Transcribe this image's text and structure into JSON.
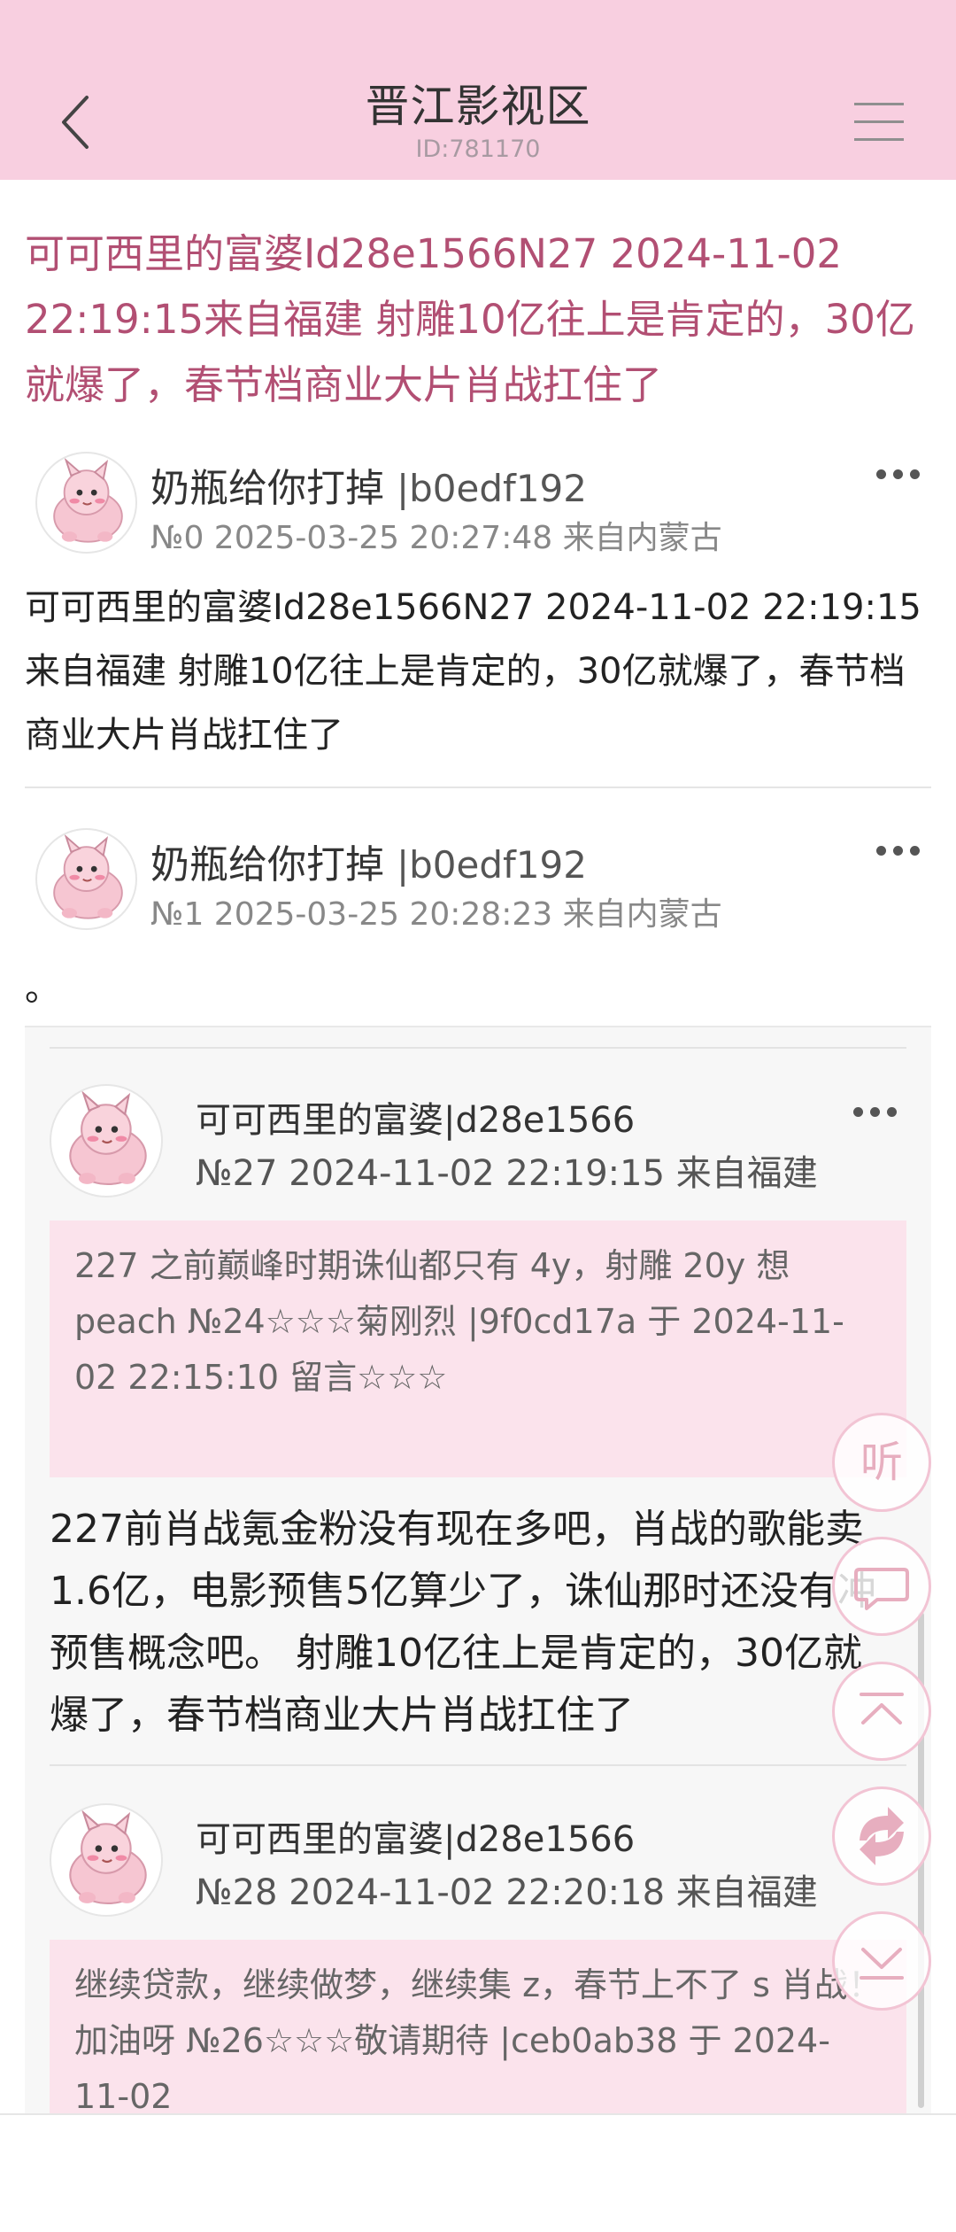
{
  "header": {
    "title": "晋江影视区",
    "id_label": "ID:781170"
  },
  "thread": {
    "title": "可可西里的富婆Id28e1566N27 2024-11-02 22:19:15来自福建 射雕10亿往上是肯定的，30亿就爆了，春节档商业大片肖战扛住了"
  },
  "posts": [
    {
      "author": "奶瓶给你打掉",
      "uid": "|b0edf192",
      "meta": "№0 2025-03-25 20:27:48 来自内蒙古",
      "body": "可可西里的富婆Id28e1566N27 2024-11-02 22:19:15来自福建 射雕10亿往上是肯定的，30亿就爆了，春节档商业大片肖战扛住了"
    },
    {
      "author": "奶瓶给你打掉",
      "uid": "|b0edf192",
      "meta": "№1 2025-03-25 20:28:23 来自内蒙古",
      "body": "。"
    }
  ],
  "quoted": [
    {
      "author": "可可西里的富婆|d28e1566",
      "meta": "№27  2024-11-02 22:19:15 来自福建",
      "reply": "227 之前巅峰时期诛仙都只有 4y，射雕 20y 想 peach №24☆☆☆菊刚烈 |9f0cd17a 于 2024-11-02 22:15:10 留言☆☆☆",
      "body": "227前肖战氪金粉没有现在多吧，肖战的歌能卖1.6亿，电影预售5亿算少了，诛仙那时还没有冲预售概念吧。 射雕10亿往上是肯定的，30亿就爆了，春节档商业大片肖战扛住了"
    },
    {
      "author": "可可西里的富婆|d28e1566",
      "meta": "№28  2024-11-02 22:20:18 来自福建",
      "reply": "继续贷款，继续做梦，继续集 z，春节上不了 s 肖战！加油呀 №26☆☆☆敬请期待 |ceb0ab38 于 2024-11-02"
    }
  ],
  "floating": {
    "listen_label": "听"
  },
  "icons": [
    "back-arrow-icon",
    "menu-icon",
    "more-icon",
    "comment-icon",
    "scroll-top-icon",
    "refresh-icon",
    "scroll-bottom-icon",
    "pig-avatar-icon"
  ],
  "colors": {
    "header_bg": "#f8cfe0",
    "title_accent": "#b24f73",
    "reply_bg": "#fbe3ec",
    "float_icon": "#e7aebf"
  }
}
